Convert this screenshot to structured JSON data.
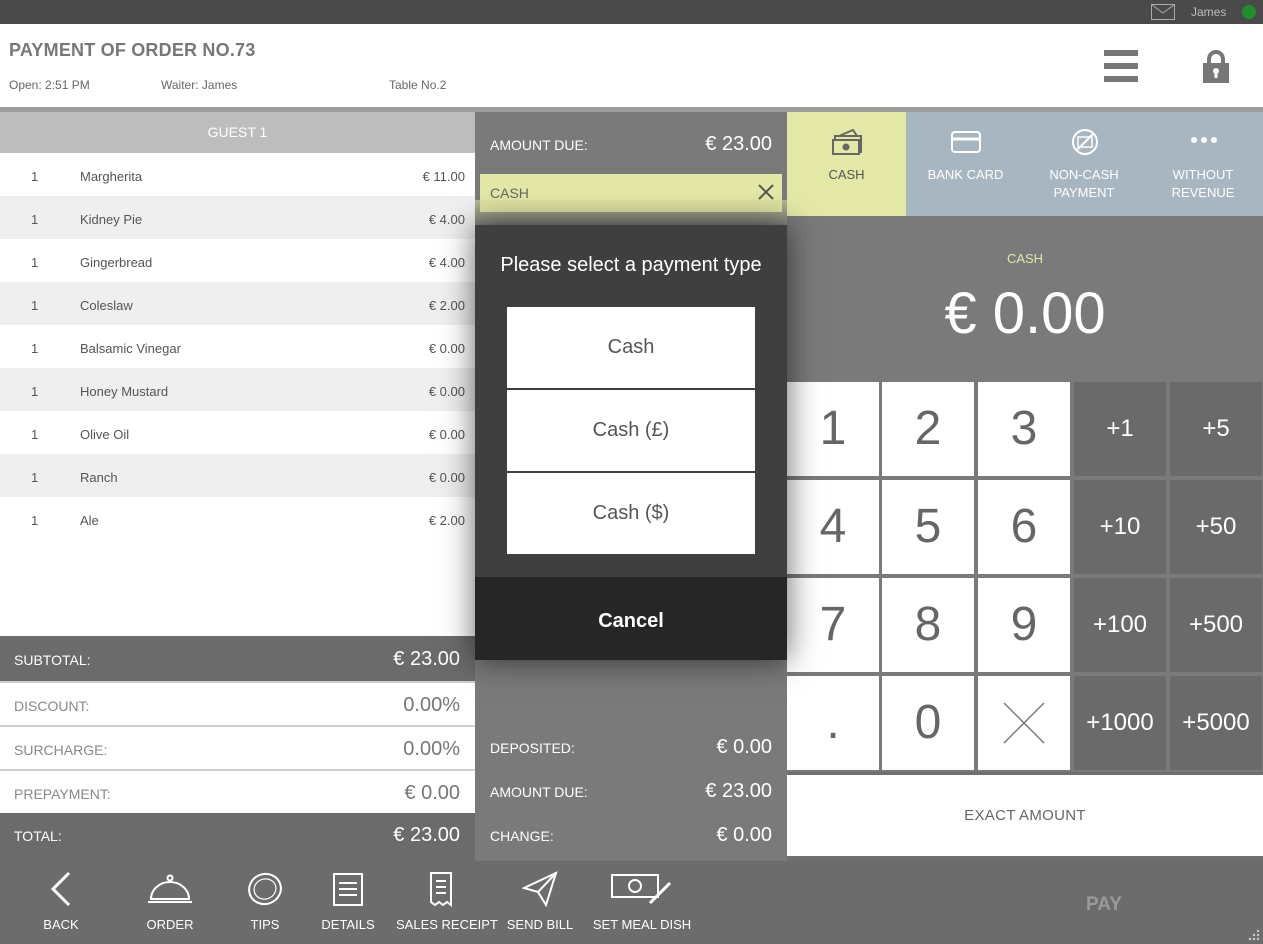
{
  "topbar": {
    "user": "James",
    "mail_icon": "mail-icon",
    "status_color": "#1e8f2a"
  },
  "header": {
    "title": "PAYMENT OF ORDER NO.73",
    "open": "Open: 2:51 PM",
    "waiter": "Waiter: James",
    "table": "Table No.2"
  },
  "guest": "GUEST 1",
  "items": [
    {
      "qty": "1",
      "name": "Margherita",
      "price": "€ 11.00"
    },
    {
      "qty": "1",
      "name": "Kidney Pie",
      "price": "€ 4.00"
    },
    {
      "qty": "1",
      "name": "Gingerbread",
      "price": "€ 4.00"
    },
    {
      "qty": "1",
      "name": "Coleslaw",
      "price": "€ 2.00"
    },
    {
      "qty": "1",
      "name": "Balsamic Vinegar",
      "price": "€ 0.00"
    },
    {
      "qty": "1",
      "name": "Honey Mustard",
      "price": "€ 0.00"
    },
    {
      "qty": "1",
      "name": "Olive Oil",
      "price": "€ 0.00"
    },
    {
      "qty": "1",
      "name": "Ranch",
      "price": "€ 0.00"
    },
    {
      "qty": "1",
      "name": "Ale",
      "price": "€ 2.00"
    }
  ],
  "totals": {
    "subtotal_label": "SUBTOTAL:",
    "subtotal": "€ 23.00",
    "discount_label": "DISCOUNT:",
    "discount": "0.00%",
    "surcharge_label": "SURCHARGE:",
    "surcharge": "0.00%",
    "prepayment_label": "PREPAYMENT:",
    "prepayment": "€ 0.00",
    "total_label": "TOTAL:",
    "total": "€ 23.00"
  },
  "middle": {
    "amount_due_label": "AMOUNT DUE:",
    "amount_due": "€ 23.00",
    "cash_chip": "CASH",
    "deposited_label": "DEPOSITED:",
    "deposited": "€ 0.00",
    "amount_due2_label": "AMOUNT DUE:",
    "amount_due2": "€ 23.00",
    "change_label": "CHANGE:",
    "change": "€ 0.00"
  },
  "tabs": [
    {
      "label": "CASH",
      "icon": "cash-icon"
    },
    {
      "label": "BANK CARD",
      "icon": "card-icon"
    },
    {
      "label": "NON-CASH PAYMENT",
      "icon": "non-cash-icon"
    },
    {
      "label": "WITHOUT REVENUE",
      "icon": "more-icon"
    }
  ],
  "amount": {
    "label": "CASH",
    "value": "€ 0.00"
  },
  "keypad": {
    "digits": [
      "1",
      "2",
      "3",
      "4",
      "5",
      "6",
      "7",
      "8",
      "9",
      ".",
      "0"
    ],
    "increments": [
      "+1",
      "+5",
      "+10",
      "+50",
      "+100",
      "+500",
      "+1000",
      "+5000"
    ]
  },
  "exact_amount": "EXACT AMOUNT",
  "toolbar": {
    "back": "BACK",
    "order": "ORDER",
    "tips": "TIPS",
    "details": "DETAILS",
    "sales_receipt": "SALES RECEIPT",
    "send_bill": "SEND BILL",
    "set_meal_dish": "SET MEAL DISH",
    "pay": "PAY"
  },
  "modal": {
    "question": "Please select a payment type",
    "options": [
      "Cash",
      "Cash (£)",
      "Cash ($)"
    ],
    "cancel": "Cancel"
  },
  "colors": {
    "accent": "#e4e8a6",
    "tab": "#a7b6c0",
    "panel": "#7a7a7a"
  }
}
